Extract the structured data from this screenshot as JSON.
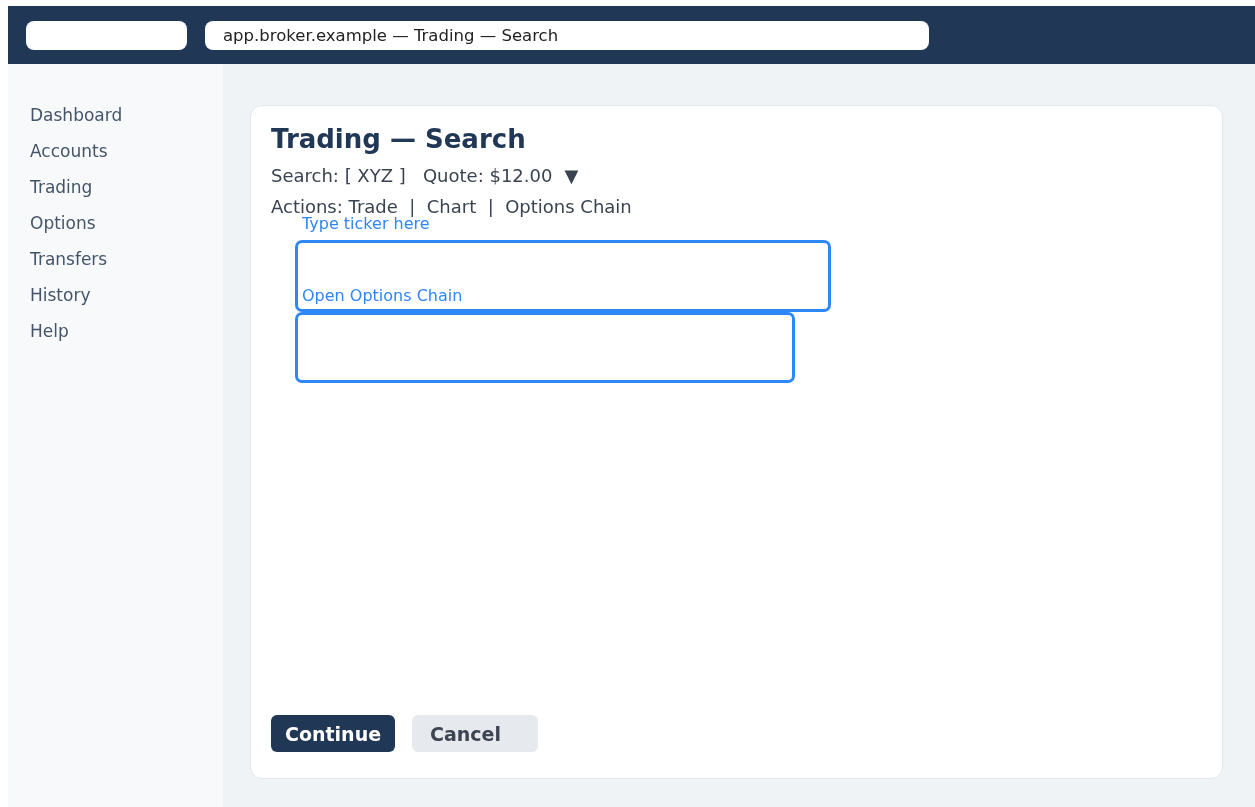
{
  "browser_bar": {
    "address": "app.broker.example — Trading — Search"
  },
  "sidebar": {
    "items": [
      "Dashboard",
      "Accounts",
      "Trading",
      "Options",
      "Transfers",
      "History",
      "Help"
    ]
  },
  "card": {
    "title": "Trading — Search",
    "search_line": "Search: [ XYZ ]   Quote: $12.00",
    "dropdown_arrow": "▼",
    "actions_line": "Actions: Trade  |  Chart  |  Options Chain",
    "annotations": [
      {
        "label": "Type ticker here"
      },
      {
        "label": "Open Options Chain"
      }
    ],
    "buttons": [
      {
        "label": "Continue",
        "kind": "primary"
      },
      {
        "label": "Cancel",
        "kind": "secondary"
      }
    ]
  }
}
